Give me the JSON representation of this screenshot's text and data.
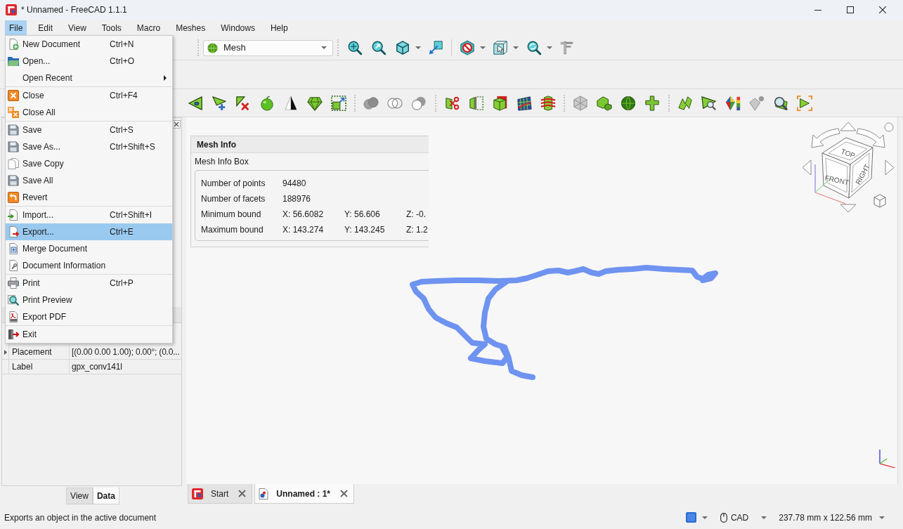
{
  "window": {
    "title": "* Unnamed - FreeCAD 1.1.1"
  },
  "menu_bar": [
    {
      "label": "File",
      "selected": true
    },
    {
      "label": "Edit",
      "selected": false
    },
    {
      "label": "View",
      "selected": false
    },
    {
      "label": "Tools",
      "selected": false
    },
    {
      "label": "Macro",
      "selected": false
    },
    {
      "label": "Meshes",
      "selected": false
    },
    {
      "label": "Windows",
      "selected": false
    },
    {
      "label": "Help",
      "selected": false
    }
  ],
  "file_menu": {
    "groups": [
      {
        "items": [
          {
            "label": "New Document",
            "shortcut": "Ctrl+N",
            "selected": false,
            "submenu": false
          },
          {
            "label": "Open...",
            "shortcut": "Ctrl+O",
            "selected": false,
            "submenu": false
          },
          {
            "label": "Open Recent",
            "selected": false,
            "submenu": true
          }
        ]
      },
      {
        "items": [
          {
            "label": "Close",
            "shortcut": "Ctrl+F4",
            "selected": false,
            "submenu": false
          },
          {
            "label": "Close All",
            "selected": false,
            "submenu": false
          }
        ]
      },
      {
        "items": [
          {
            "label": "Save",
            "shortcut": "Ctrl+S",
            "selected": false,
            "submenu": false
          },
          {
            "label": "Save As...",
            "shortcut": "Ctrl+Shift+S",
            "selected": false,
            "submenu": false
          },
          {
            "label": "Save Copy",
            "selected": false,
            "submenu": false
          },
          {
            "label": "Save All",
            "selected": false,
            "submenu": false
          },
          {
            "label": "Revert",
            "selected": false,
            "submenu": false
          }
        ]
      },
      {
        "items": [
          {
            "label": "Import...",
            "shortcut": "Ctrl+Shift+I",
            "selected": false,
            "submenu": false
          },
          {
            "label": "Export...",
            "shortcut": "Ctrl+E",
            "selected": true,
            "submenu": false
          },
          {
            "label": "Merge Document",
            "selected": false,
            "submenu": false
          },
          {
            "label": "Document Information",
            "selected": false,
            "submenu": false
          }
        ]
      },
      {
        "items": [
          {
            "label": "Print",
            "shortcut": "Ctrl+P",
            "selected": false,
            "submenu": false
          },
          {
            "label": "Print Preview",
            "selected": false,
            "submenu": false
          },
          {
            "label": "Export PDF",
            "selected": false,
            "submenu": false
          }
        ]
      },
      {
        "items": [
          {
            "label": "Exit",
            "selected": false,
            "submenu": false
          }
        ]
      }
    ]
  },
  "toolbar": {
    "workbench": "Mesh"
  },
  "combo_view": {
    "properties": [
      {
        "name": "Placement",
        "value": "[(0.00 0.00 1.00); 0.00°; (0.0...",
        "has_children": true
      },
      {
        "name": "Label",
        "value": "gpx_conv141l",
        "has_children": false
      }
    ],
    "tabs": [
      {
        "label": "View",
        "selected": false
      },
      {
        "label": "Data",
        "selected": true
      }
    ]
  },
  "mesh_info": {
    "title": "Mesh Info",
    "group_title": "Mesh Info Box",
    "rows": [
      {
        "label": "Number of points",
        "values": [
          "94480"
        ]
      },
      {
        "label": "Number of facets",
        "values": [
          "188976"
        ]
      },
      {
        "label": "Minimum bound",
        "values": [
          "X: 56.6082",
          "Y: 56.606",
          "Z: -0."
        ]
      },
      {
        "label": "Maximum bound",
        "values": [
          "X: 143.274",
          "Y: 143.245",
          "Z: 1.2"
        ]
      }
    ]
  },
  "nav_cube": {
    "faces": [
      "TOP",
      "FRONT",
      "RIGHT"
    ]
  },
  "document_tabs": [
    {
      "label": "Start",
      "selected": false
    },
    {
      "label": "Unnamed : 1*",
      "selected": true
    }
  ],
  "status_bar": {
    "message": "Exports an object in the active document",
    "navigation_style": "CAD",
    "dimensions": "237.78 mm x 122.56 mm"
  }
}
